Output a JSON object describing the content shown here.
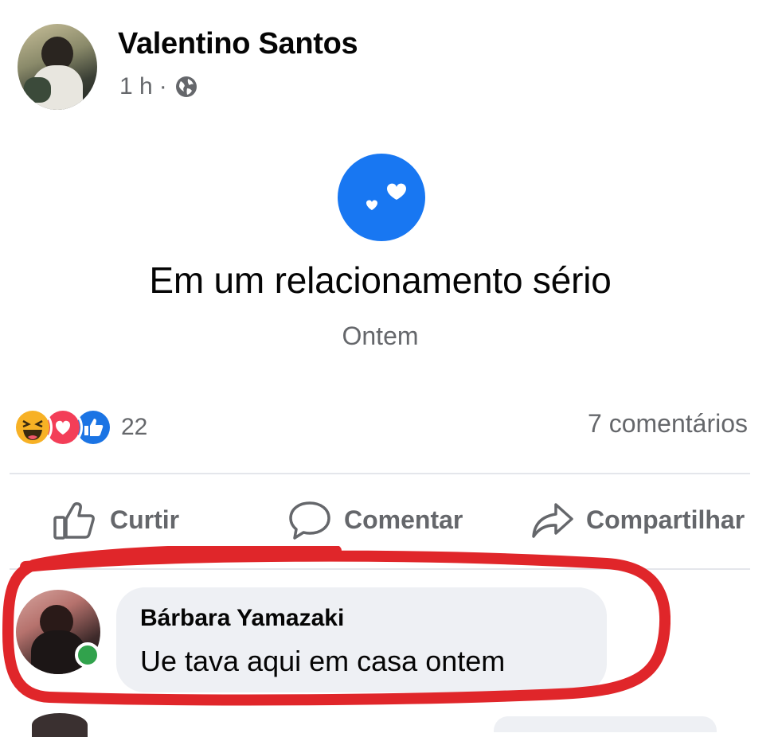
{
  "post": {
    "author": "Valentino Santos",
    "time": "1 h",
    "separator": "·",
    "privacy_icon": "globe-icon",
    "life_event": {
      "icon": "hearts-icon",
      "title": "Em um relacionamento sério",
      "date": "Ontem"
    },
    "reactions": {
      "icons": [
        "haha-icon",
        "love-icon",
        "like-icon"
      ],
      "count": "22"
    },
    "comments_count": "7 comentários",
    "actions": {
      "like": "Curtir",
      "comment": "Comentar",
      "share": "Compartilhar"
    }
  },
  "comment": {
    "author": "Bárbara Yamazaki",
    "text": "Ue tava aqui em casa ontem",
    "online": true
  },
  "colors": {
    "accent": "#1877f2",
    "highlight_circle": "#e0262a",
    "online": "#31a24c",
    "secondary_text": "#65676b"
  }
}
